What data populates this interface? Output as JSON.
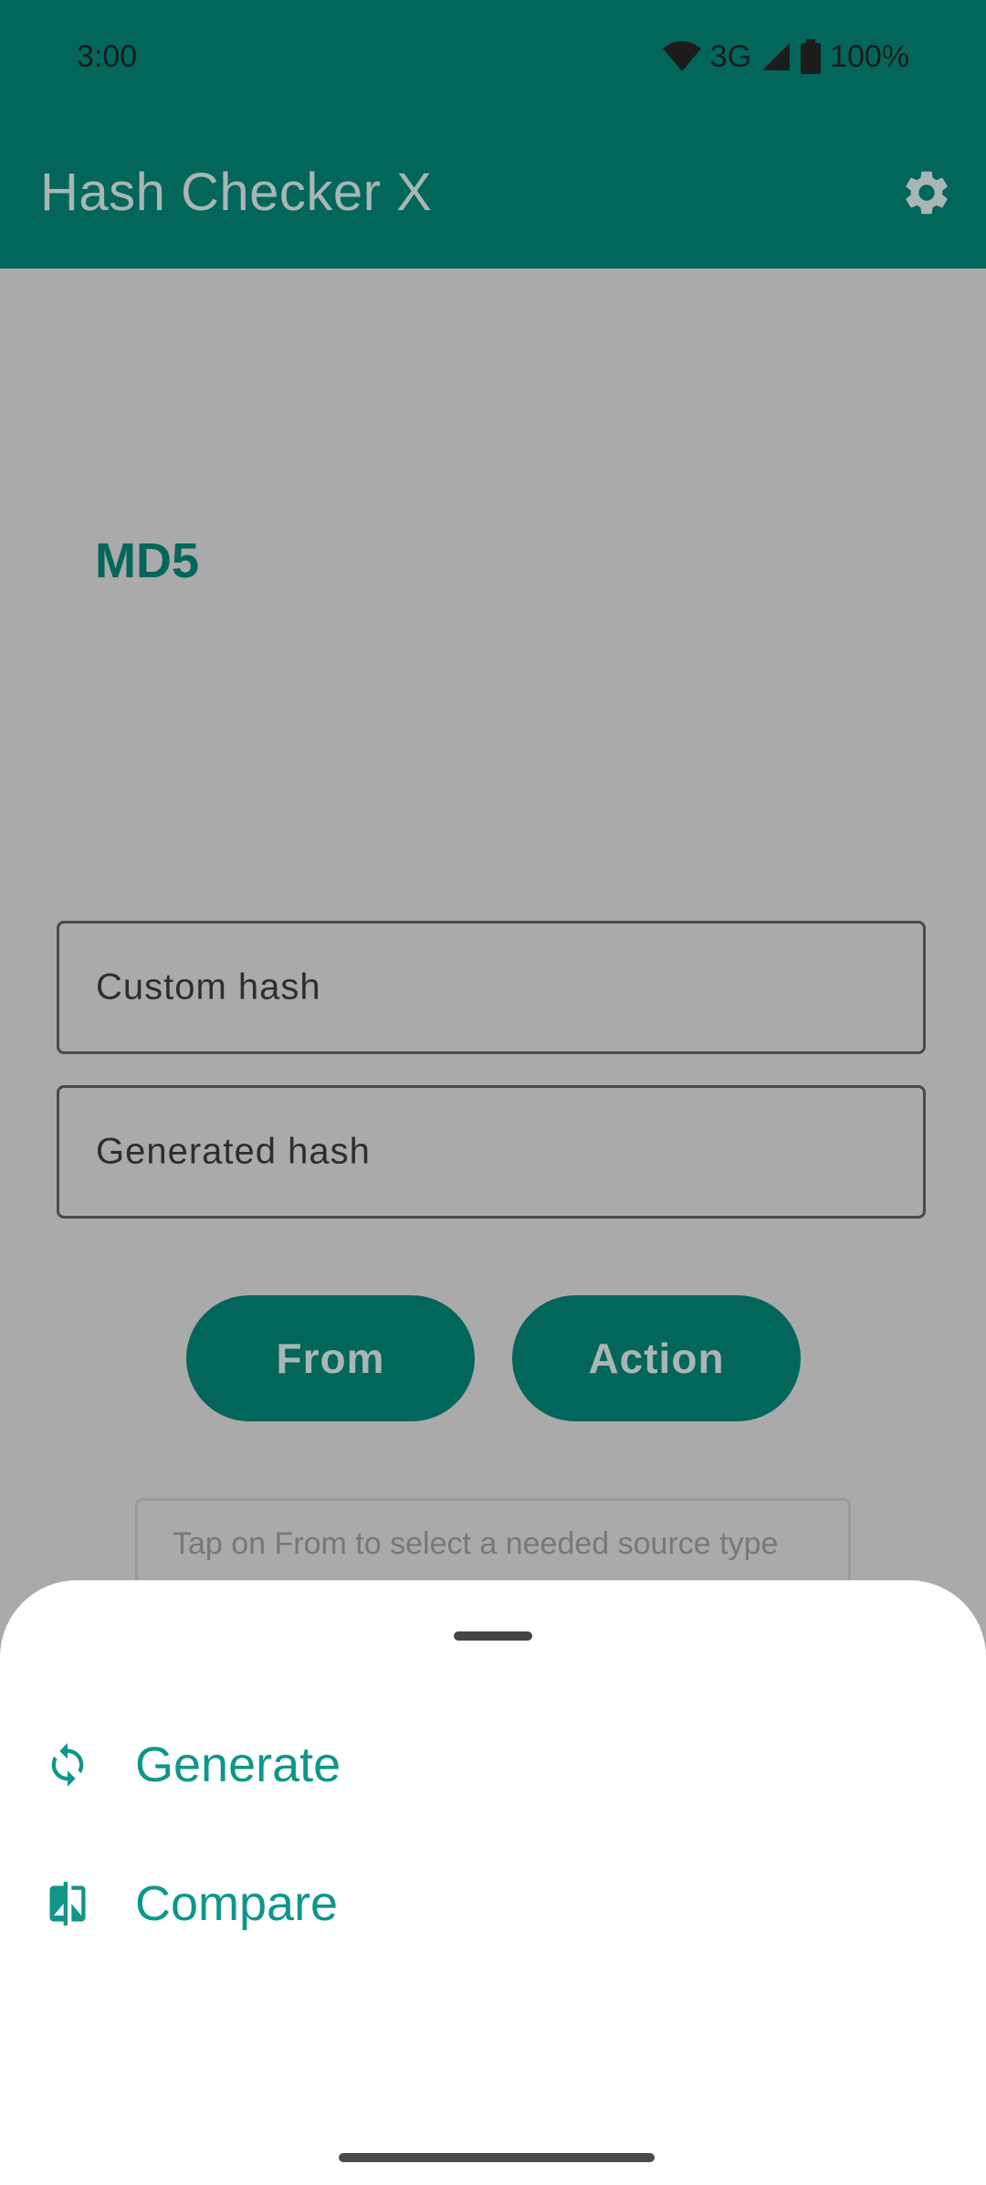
{
  "status_bar": {
    "time": "3:00",
    "network": "3G",
    "battery": "100%"
  },
  "app_bar": {
    "title": "Hash Checker X",
    "settings_icon": "gear-icon"
  },
  "main": {
    "algorithm": "MD5",
    "custom_hash_label": "Custom hash",
    "generated_hash_label": "Generated hash",
    "from_button": "From",
    "action_button": "Action",
    "hint": "Tap on From to select a needed source type"
  },
  "bottom_sheet": {
    "items": [
      {
        "label": "Generate",
        "icon": "refresh-icon"
      },
      {
        "label": "Compare",
        "icon": "compare-icon"
      }
    ]
  },
  "colors": {
    "primary_dimmed": "#02665b",
    "accent": "#0f968a",
    "scrim": "#aaaaaa"
  }
}
